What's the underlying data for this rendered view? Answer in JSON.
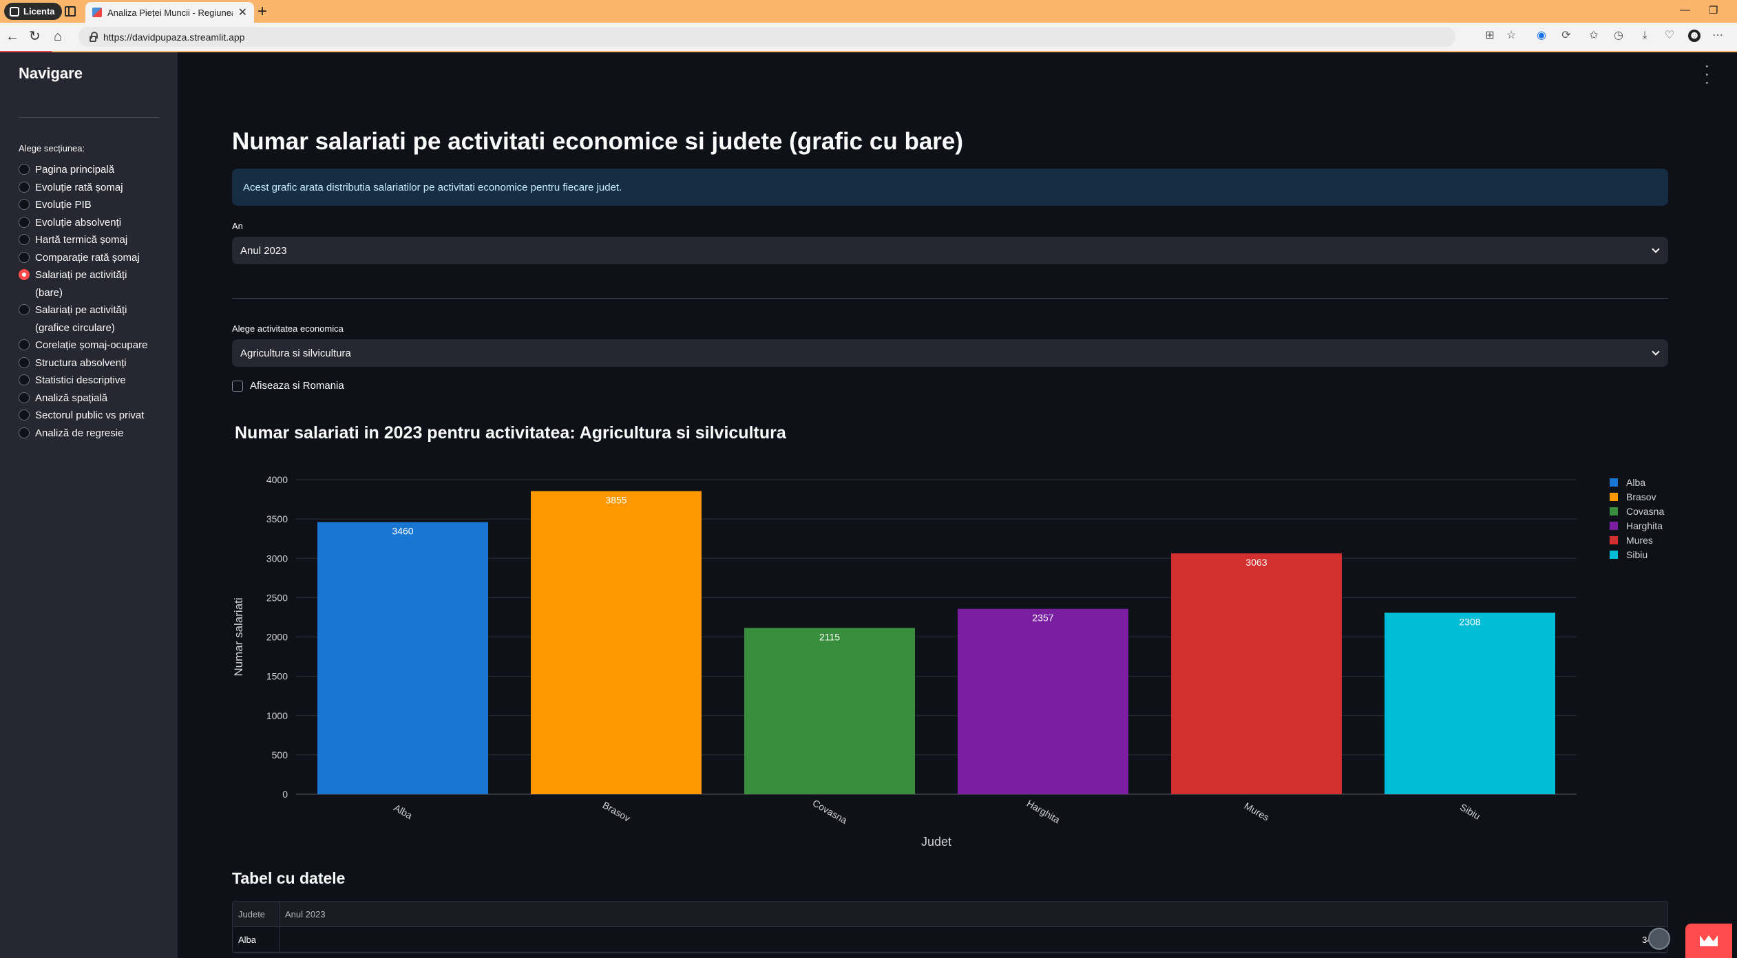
{
  "browser": {
    "profile_label": "Licenta",
    "tab_title": "Analiza Pieței Muncii - Regiunea C",
    "url": "https://davidpupaza.streamlit.app"
  },
  "sidebar": {
    "title": "Navigare",
    "radio_label": "Alege secțiunea:",
    "items": [
      {
        "label": "Pagina principală",
        "selected": false
      },
      {
        "label": "Evoluție rată șomaj",
        "selected": false
      },
      {
        "label": "Evoluție PIB",
        "selected": false
      },
      {
        "label": "Evoluție absolvenți",
        "selected": false
      },
      {
        "label": "Hartă termică șomaj",
        "selected": false
      },
      {
        "label": "Comparație rată șomaj",
        "selected": false
      },
      {
        "label": "Salariați pe activități (bare)",
        "selected": true
      },
      {
        "label": "Salariați pe activități (grafice circulare)",
        "selected": false
      },
      {
        "label": "Corelație șomaj-ocupare",
        "selected": false
      },
      {
        "label": "Structura absolvenți",
        "selected": false
      },
      {
        "label": "Statistici descriptive",
        "selected": false
      },
      {
        "label": "Analiză spațială",
        "selected": false
      },
      {
        "label": "Sectorul public vs privat",
        "selected": false
      },
      {
        "label": "Analiză de regresie",
        "selected": false
      }
    ]
  },
  "main": {
    "title": "Numar salariati pe activitati economice si judete (grafic cu bare)",
    "info": "Acest grafic arata distributia salariatilor pe activitati economice pentru fiecare judet.",
    "year_label": "An",
    "year_value": "Anul 2023",
    "activity_label": "Alege activitatea economica",
    "activity_value": "Agricultura si silvicultura",
    "checkbox_label": "Afiseaza si Romania",
    "checkbox_checked": false,
    "chart_title": "Numar salariati in 2023 pentru activitatea: Agricultura si silvicultura",
    "table_title": "Tabel cu datele",
    "table": {
      "columns": [
        "Judete",
        "Anul 2023"
      ],
      "rows": [
        [
          "Alba",
          "3460"
        ]
      ]
    }
  },
  "chart_data": {
    "type": "bar",
    "title": "Numar salariati in 2023 pentru activitatea: Agricultura si silvicultura",
    "xlabel": "Judet",
    "ylabel": "Numar salariati",
    "categories": [
      "Alba",
      "Brasov",
      "Covasna",
      "Harghita",
      "Mures",
      "Sibiu"
    ],
    "values": [
      3460,
      3855,
      2115,
      2357,
      3063,
      2308
    ],
    "colors": [
      "#1976d2",
      "#ff9800",
      "#388e3c",
      "#7b1fa2",
      "#d32f2f",
      "#00bcd4"
    ],
    "ylim": [
      0,
      4000
    ],
    "yticks": [
      0,
      500,
      1000,
      1500,
      2000,
      2500,
      3000,
      3500,
      4000
    ],
    "grid": true,
    "legend": "top-right"
  }
}
